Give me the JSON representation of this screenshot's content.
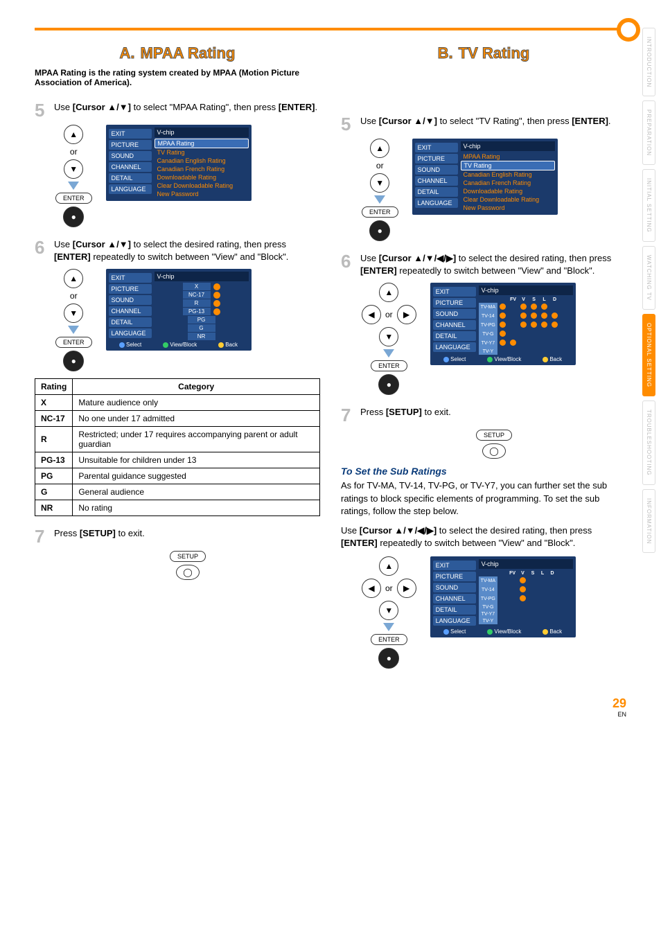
{
  "side_tabs": [
    "INTRODUCTION",
    "PREPARATION",
    "INITIAL SETTING",
    "WATCHING TV",
    "OPTIONAL SETTING",
    "TROUBLESHOOTING",
    "INFORMATION"
  ],
  "side_tab_active_index": 4,
  "section_a": {
    "letter": "A.",
    "title": "MPAA Rating",
    "intro": "MPAA Rating is the rating system created by MPAA (Motion Picture Association of America).",
    "step5": {
      "num": "5",
      "pre": "Use ",
      "cmd": "[Cursor ▲/▼]",
      "mid": " to select \"MPAA Rating\", then press ",
      "cmd2": "[ENTER]",
      "post": "."
    },
    "step6": {
      "num": "6",
      "pre": "Use ",
      "cmd": "[Cursor ▲/▼]",
      "mid": " to select the desired rating, then press ",
      "cmd2": "[ENTER]",
      "post": " repeatedly to switch between \"View\" and \"Block\"."
    },
    "step7": {
      "num": "7",
      "pre": "Press ",
      "cmd": "[SETUP]",
      "post": " to exit."
    }
  },
  "section_b": {
    "letter": "B.",
    "title": "TV Rating",
    "step5": {
      "num": "5",
      "pre": "Use ",
      "cmd": "[Cursor ▲/▼]",
      "mid": " to select \"TV Rating\", then press ",
      "cmd2": "[ENTER]",
      "post": "."
    },
    "step6": {
      "num": "6",
      "pre": "Use ",
      "cmd": "[Cursor ▲/▼/◀/▶]",
      "mid": " to select the desired rating, then press ",
      "cmd2": "[ENTER]",
      "post": " repeatedly to switch between \"View\" and \"Block\"."
    },
    "step7": {
      "num": "7",
      "pre": "Press ",
      "cmd": "[SETUP]",
      "post": " to exit."
    },
    "sub_heading": "To Set the Sub Ratings",
    "sub_para": "As for TV-MA, TV-14, TV-PG, or TV-Y7, you can further set the sub ratings to block specific elements of programming. To set the sub ratings, follow the step below.",
    "sub_instr": {
      "pre": "Use ",
      "cmd": "[Cursor ▲/▼/◀/▶]",
      "mid": " to select the desired rating, then press ",
      "cmd2": "[ENTER]",
      "post": " repeatedly to switch between \"View\" and \"Block\"."
    }
  },
  "remote": {
    "or": "or",
    "enter": "ENTER",
    "setup": "SETUP",
    "up": "▲",
    "down": "▼",
    "left": "◀",
    "right": "▶",
    "oval": "●"
  },
  "osd_side": [
    "EXIT",
    "PICTURE",
    "SOUND",
    "CHANNEL",
    "DETAIL",
    "LANGUAGE"
  ],
  "osd_vchip_title": "V-chip",
  "osd_vchip_items": [
    "MPAA Rating",
    "TV Rating",
    "Canadian English Rating",
    "Canadian French Rating",
    "Downloadable Rating",
    "Clear Downloadable Rating",
    "New Password"
  ],
  "osd_footer": {
    "select": "Select",
    "viewblock": "View/Block",
    "back": "Back"
  },
  "mpaa_osd_list": [
    "X",
    "NC-17",
    "R",
    "PG-13",
    "PG",
    "G",
    "NR"
  ],
  "tv_grid": {
    "cols": [
      "FV",
      "V",
      "S",
      "L",
      "D"
    ],
    "rows": [
      "TV-MA",
      "TV-14",
      "TV-PG",
      "TV-G",
      "TV-Y7",
      "TV-Y"
    ]
  },
  "rating_table": {
    "headers": [
      "Rating",
      "Category"
    ],
    "rows": [
      [
        "X",
        "Mature audience only"
      ],
      [
        "NC-17",
        "No one under 17 admitted"
      ],
      [
        "R",
        "Restricted; under 17 requires accompanying parent or adult guardian"
      ],
      [
        "PG-13",
        "Unsuitable for children under 13"
      ],
      [
        "PG",
        "Parental guidance suggested"
      ],
      [
        "G",
        "General audience"
      ],
      [
        "NR",
        "No rating"
      ]
    ]
  },
  "page": {
    "num": "29",
    "suffix": "EN"
  }
}
